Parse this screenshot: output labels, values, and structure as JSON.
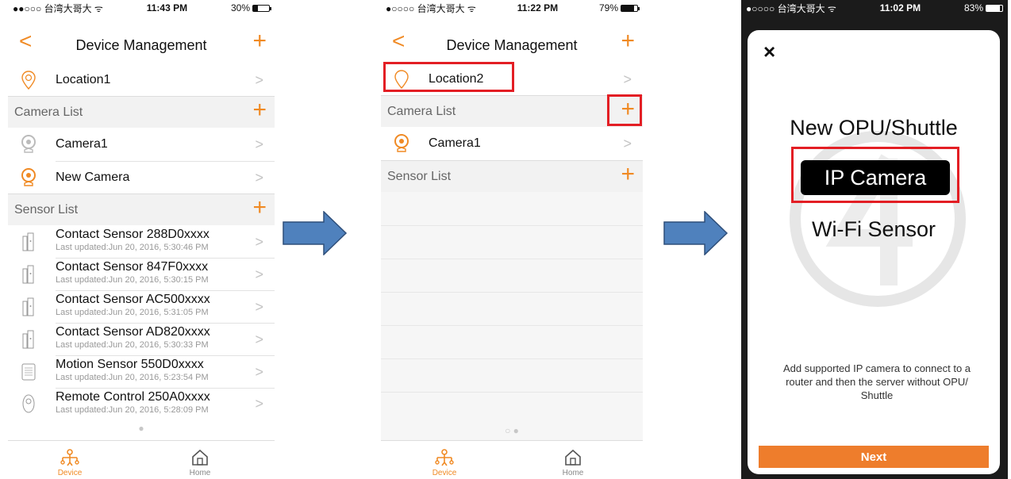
{
  "screen1": {
    "status": {
      "carrier": "●●○○○ 台湾大哥大 ᯤ",
      "time": "11:43 PM",
      "battery": "30%",
      "battery_level": 0.3
    },
    "nav": {
      "title": "Device Management",
      "back": "<",
      "add": "+"
    },
    "location": {
      "label": "Location1"
    },
    "camera_section": {
      "title": "Camera List",
      "add": "+"
    },
    "cameras": [
      {
        "label": "Camera1"
      },
      {
        "label": "New Camera"
      }
    ],
    "sensor_section": {
      "title": "Sensor List",
      "add": "+"
    },
    "sensors": [
      {
        "name": "Contact Sensor 288D0xxxx",
        "updated": "Last updated:Jun 20, 2016, 5:30:46 PM"
      },
      {
        "name": "Contact Sensor 847F0xxxx",
        "updated": "Last updated:Jun 20, 2016, 5:30:15 PM"
      },
      {
        "name": "Contact Sensor AC500xxxx",
        "updated": "Last updated:Jun 20, 2016, 5:31:05 PM"
      },
      {
        "name": "Contact Sensor AD820xxxx",
        "updated": "Last updated:Jun 20, 2016, 5:30:33 PM"
      },
      {
        "name": "Motion Sensor 550D0xxxx",
        "updated": "Last updated:Jun 20, 2016, 5:23:54 PM"
      },
      {
        "name": "Remote Control 250A0xxxx",
        "updated": "Last updated:Jun 20, 2016, 5:28:09 PM"
      }
    ],
    "page_dots": "●",
    "tabs": {
      "device": "Device",
      "home": "Home"
    }
  },
  "screen2": {
    "status": {
      "carrier": "●○○○○ 台湾大哥大 ᯤ",
      "time": "11:22 PM",
      "battery": "79%",
      "battery_level": 0.79
    },
    "nav": {
      "title": "Device Management",
      "back": "<",
      "add": "+"
    },
    "location": {
      "label": "Location2"
    },
    "camera_section": {
      "title": "Camera List",
      "add": "+"
    },
    "cameras": [
      {
        "label": "Camera1"
      }
    ],
    "sensor_section": {
      "title": "Sensor List",
      "add": "+"
    },
    "page_dots": "○ ●",
    "tabs": {
      "device": "Device",
      "home": "Home"
    }
  },
  "screen3": {
    "status": {
      "carrier": "●○○○○ 台湾大哥大 ᯤ",
      "time": "11:02 PM",
      "battery": "83%",
      "battery_level": 0.83
    },
    "close": "×",
    "options": {
      "opu": "New OPU/Shuttle",
      "ip_camera": "IP Camera",
      "wifi": "Wi-Fi Sensor"
    },
    "description": "Add supported IP camera to connect to a router and then the server without OPU/ Shuttle",
    "next": "Next"
  },
  "colors": {
    "accent": "#f08a24",
    "highlight": "#e31e24",
    "arrow_fill": "#4f81bd",
    "arrow_stroke": "#2f4f7a"
  }
}
